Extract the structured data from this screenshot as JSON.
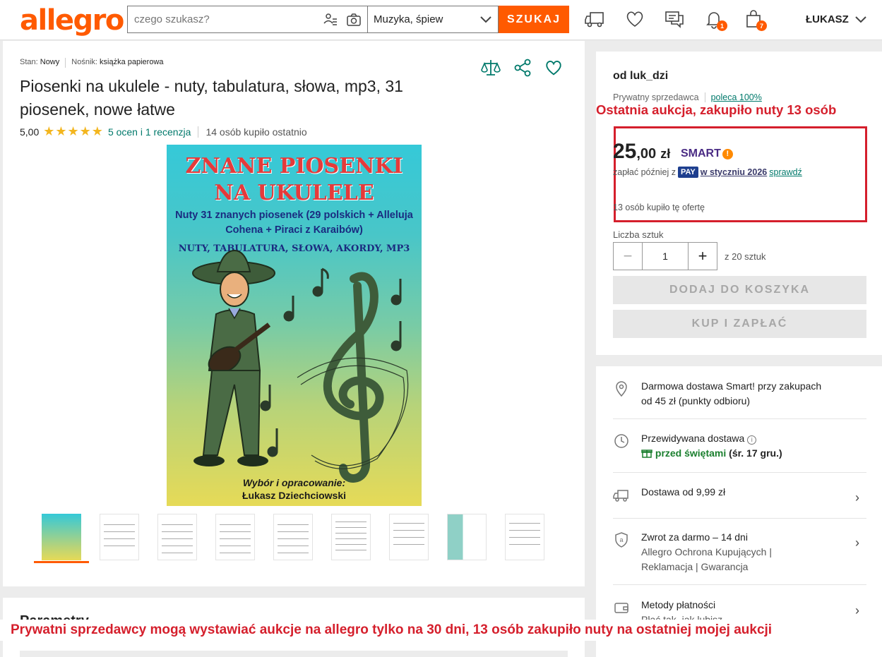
{
  "header": {
    "logo": "allegro",
    "search_placeholder": "czego szukasz?",
    "category": "Muzyka, śpiew",
    "search_button": "SZUKAJ",
    "notifications_badge": "1",
    "cart_badge": "7",
    "user": "ŁUKASZ",
    "accent_color": "#ff5a00"
  },
  "product": {
    "condition_label": "Stan:",
    "condition_value": "Nowy",
    "medium_label": "Nośnik:",
    "medium_value": "książka papierowa",
    "title": "Piosenki na ukulele - nuty, tabulatura, słowa, mp3, 31 piosenek, nowe łatwe",
    "rating_value": "5,00",
    "stars": "★★★★★",
    "rating_link": "5 ocen i 1 recenzja",
    "bought_recently": "14 osób kupiło ostatnio"
  },
  "cover": {
    "title_line1": "ZNANE PIOSENKI",
    "title_line2": "NA UKULELE",
    "subtitle": "Nuty 31 znanych piosenek (29 polskich + Alleluja Cohena + Piraci z Karaibów)",
    "subtitle2": "NUTY, TABULATURA, SŁOWA, AKORDY, MP3",
    "author_intro": "Wybór i opracowanie:",
    "author_name": "Łukasz Dziechciowski"
  },
  "thumbnails": [
    "cover",
    "page",
    "page",
    "page",
    "page",
    "page",
    "page",
    "page",
    "page"
  ],
  "section2_title": "Parametry",
  "seller": {
    "name": "od luk_dzi",
    "type": "Prywatny sprzedawca",
    "recommend": "poleca 100%"
  },
  "annotation_top": "Ostatnia aukcja, zakupiło nuty 13 osób",
  "price": {
    "int": "25",
    "dec": ",00",
    "currency": "zł",
    "smart": "SMART",
    "later_prefix": "zapłać później z",
    "pay_badge": "PAY",
    "later_when": "w styczniu 2026",
    "later_check": "sprawdź",
    "bought": "13 osób kupiło tę ofertę"
  },
  "quantity": {
    "label": "Liczba sztuk",
    "value": "1",
    "of": "z 20 sztuk"
  },
  "buttons": {
    "add_to_cart": "DODAJ DO KOSZYKA",
    "buy_now": "KUP I ZAPŁAĆ"
  },
  "shipping": {
    "free_line1": "Darmowa dostawa Smart! przy zakupach",
    "free_line2": "od 45 zł (punkty odbioru)",
    "expected_label": "Przewidywana dostawa",
    "expected_green": "przed świętami",
    "expected_date": "(śr. 17 gru.)",
    "delivery_from": "Dostawa od 9,99 zł",
    "return_line1": "Zwrot za darmo – 14 dni",
    "return_line2": "Allegro Ochrona Kupujących |",
    "return_line3": "Reklamacja | Gwarancja",
    "payment_label": "Metody płatności",
    "payment_sub": "Płać tak, jak lubisz"
  },
  "annotation_bottom": "Prywatni sprzedawcy mogą wystawiać aukcje na allegro tylko na 30 dni, 13 osób zakupiło nuty na ostatniej mojej aukcji"
}
